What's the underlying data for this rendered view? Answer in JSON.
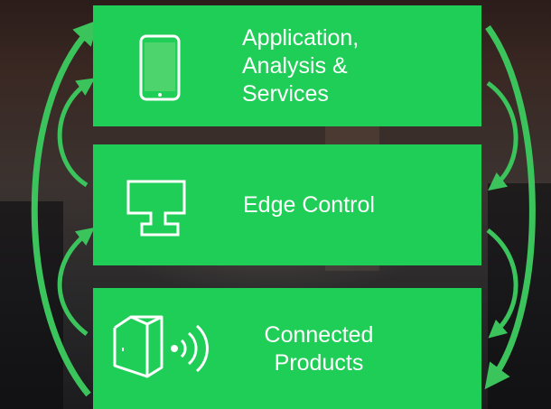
{
  "colors": {
    "box": "#1fce57",
    "arrow": "#3cc45c",
    "text": "#ffffff"
  },
  "layers": [
    {
      "id": "app",
      "icon": "smartphone-icon",
      "label": "Application,\nAnalysis &\nServices"
    },
    {
      "id": "edge",
      "icon": "monitor-icon",
      "label": "Edge Control"
    },
    {
      "id": "conn",
      "icon": "connected-door-icon",
      "label": "Connected\nProducts"
    }
  ]
}
